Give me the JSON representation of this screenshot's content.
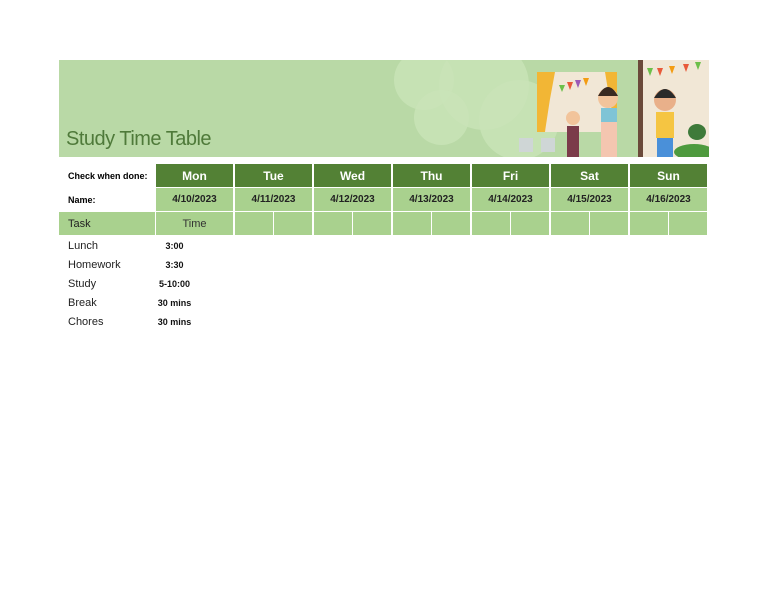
{
  "title": "Study Time Table",
  "labels": {
    "check": "Check when done:",
    "name": "Name:",
    "task": "Task",
    "time": "Time"
  },
  "days": [
    {
      "day": "Mon",
      "date": "4/10/2023"
    },
    {
      "day": "Tue",
      "date": "4/11/2023"
    },
    {
      "day": "Wed",
      "date": "4/12/2023"
    },
    {
      "day": "Thu",
      "date": "4/13/2023"
    },
    {
      "day": "Fri",
      "date": "4/14/2023"
    },
    {
      "day": "Sat",
      "date": "4/15/2023"
    },
    {
      "day": "Sun",
      "date": "4/16/2023"
    }
  ],
  "rows": [
    {
      "task": "Lunch",
      "time": "3:00"
    },
    {
      "task": "Homework",
      "time": "3:30"
    },
    {
      "task": "Study",
      "time": "5-10:00"
    },
    {
      "task": "Break",
      "time": "30 mins"
    },
    {
      "task": "Chores",
      "time": "30 mins"
    }
  ],
  "colors": {
    "header": "#538135",
    "light": "#a9d18e",
    "banner": "#b9d9a6"
  }
}
